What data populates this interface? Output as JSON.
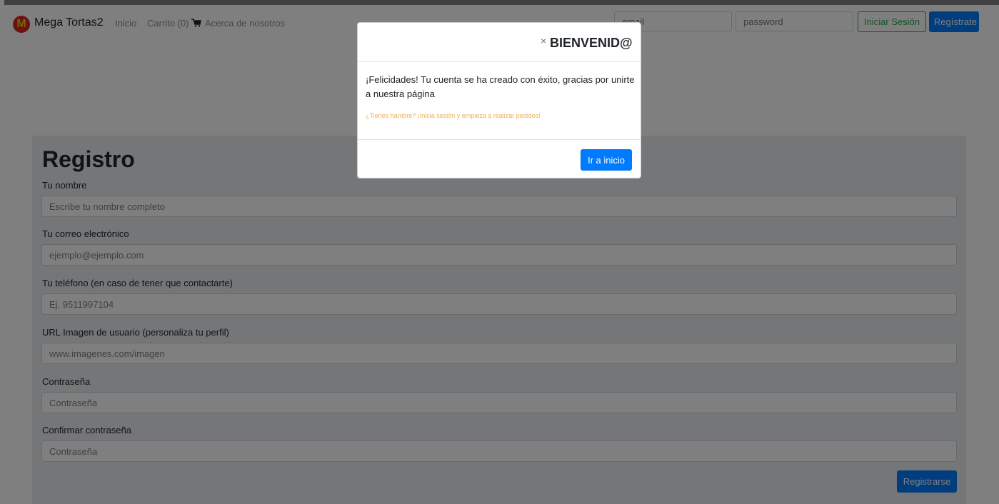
{
  "navbar": {
    "brand": "Mega Tortas2",
    "logo_letter": "M",
    "links": {
      "inicio": "Inicio",
      "carrito": "Carrito (0)",
      "acerca": "Acerca de nosotros"
    },
    "email_placeholder": "email",
    "password_placeholder": "password",
    "login_label": "Iniciar Sesión",
    "register_label": "Regístrate"
  },
  "form": {
    "title": "Registro",
    "fields": [
      {
        "label": "Tu nombre",
        "placeholder": "Escribe tu nombre completo"
      },
      {
        "label": "Tu correo electrónico",
        "placeholder": "ejemplo@ejemplo.com"
      },
      {
        "label": "Tu teléfono (en caso de tener que contactarte)",
        "placeholder": "Ej. 9511997104"
      },
      {
        "label": "URL Imagen de usuario (personaliza tu perfil)",
        "placeholder": "www.imagenes.com/imagen"
      },
      {
        "label": "Contraseña",
        "placeholder": "Contraseña"
      },
      {
        "label": "Confirmar contraseña",
        "placeholder": "Contraseña"
      }
    ],
    "submit_label": "Registrarse"
  },
  "modal": {
    "close_symbol": "×",
    "title": "BIENVENID@",
    "message": "¡Felicidades! Tu cuenta se ha creado con éxito, gracias por unirte a nuestra página",
    "hint": "¿Tienes hambre? ¡Inicia sesión y empieza a realizar pedidos!",
    "button_label": "Ir a inicio"
  },
  "colors": {
    "primary": "#007bff",
    "success": "#28a745",
    "warning": "#f0ad4e",
    "logo_red": "#d7281e",
    "logo_yellow": "#f2c614"
  },
  "icons": {
    "cart": "cart-icon",
    "logo": "mcdonalds-logo-icon",
    "close": "close-icon"
  }
}
